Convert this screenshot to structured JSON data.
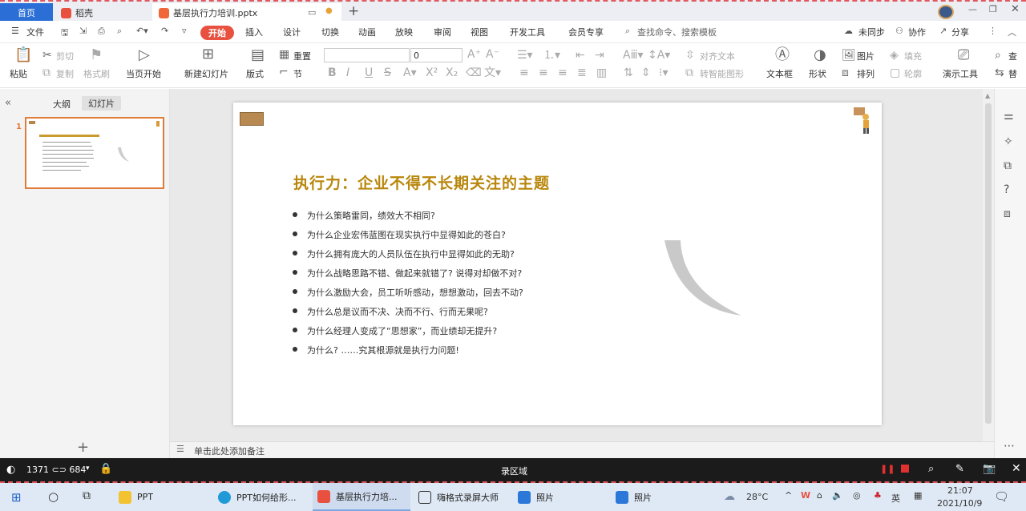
{
  "tabs": {
    "home": "首页",
    "daoke": "稻壳",
    "document": "基层执行力培训.pptx"
  },
  "menu": {
    "file": "文件",
    "start": "开始",
    "insert": "插入",
    "design": "设计",
    "transition": "切换",
    "animation": "动画",
    "slideshow": "放映",
    "review": "审阅",
    "view": "视图",
    "developer": "开发工具",
    "member": "会员专享",
    "search_placeholder": "查找命令、搜索模板",
    "unsync": "未同步",
    "collab": "协作",
    "share": "分享"
  },
  "toolbar": {
    "paste": "粘贴",
    "cut": "剪切",
    "copy": "复制",
    "format_painter": "格式刷",
    "play_from_current": "当页开始",
    "new_slide": "新建幻灯片",
    "layout": "版式",
    "reset": "重置",
    "section": "节",
    "font_size": "0",
    "align_text": "对齐文本",
    "convert_smartart": "转智能图形",
    "textbox": "文本框",
    "shape": "形状",
    "picture": "图片",
    "arrange": "排列",
    "fill": "填充",
    "outline": "轮廓",
    "presentation_tools": "演示工具",
    "find": "查",
    "replace": "替"
  },
  "left_panel": {
    "outline_tab": "大纲",
    "slides_tab": "幻灯片",
    "slide_number": "1",
    "add": "+"
  },
  "slide": {
    "title": "执行力：企业不得不长期关注的主题",
    "bullets": [
      "为什么策略雷同，绩效大不相同?",
      "为什么企业宏伟蓝图在现实执行中显得如此的苍白?",
      "为什么拥有庞大的人员队伍在执行中显得如此的无助?",
      "为什么战略思路不错、做起来就错了? 说得对却做不对?",
      "为什么激励大会，员工听听感动，想想激动，回去不动?",
      "为什么总是议而不决、决而不行、行而无果呢?",
      "为什么经理人变成了“思想家”，而业绩却无提升?",
      "为什么? ……究其根源就是执行力问题!"
    ]
  },
  "notes_placeholder": "单击此处添加备注",
  "recorder": {
    "size": "1371 ⊂⊃ 684",
    "region": "录区域"
  },
  "taskbar": {
    "items": [
      "PPT",
      "PPT如何给形...",
      "基层执行力培...",
      "嗨格式录屏大师",
      "照片",
      "照片"
    ],
    "temperature": "28°C",
    "ime": "英",
    "time": "21:07",
    "date": "2021/10/9"
  },
  "colors": {
    "accent": "#e8513f",
    "title_gold": "#b8860b",
    "windows_blue": "#2b6fd6"
  }
}
